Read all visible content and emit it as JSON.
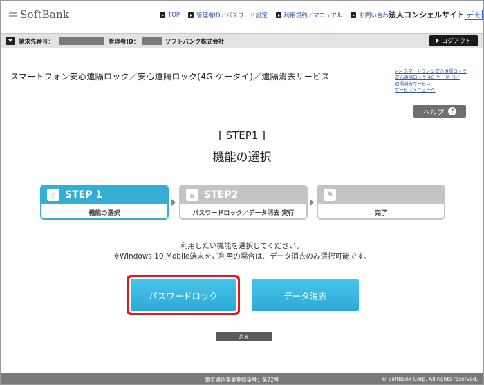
{
  "header": {
    "logo_text": "SoftBank",
    "nav": [
      {
        "label": "TOP"
      },
      {
        "label": "管理者ID／パスワード設定"
      },
      {
        "label": "利用規約／マニュアル"
      },
      {
        "label": "お問い合わせ"
      }
    ],
    "site_title": "法人コンシェルサイト",
    "site_badge": "デモ"
  },
  "account_bar": {
    "billing_label": "請求先番号：",
    "admin_label": "管理者ID：",
    "company": "ソフトバンク株式会社",
    "logout_label": "ログアウト"
  },
  "page": {
    "title": "スマートフォン安心遠隔ロック／安心遠隔ロック(4G ケータイ)／遠隔消去サービス",
    "side_links": [
      ">> スマートフォン安心遠隔ロック",
      "安心遠隔ロック(4G ケータイ)／",
      "遠隔消去サービス",
      "サービスメニューへ"
    ],
    "help_label": "ヘルプ",
    "help_icon_glyph": "?"
  },
  "step_heading": "[ STEP1 ]",
  "step_sub": "機能の選択",
  "steps": [
    {
      "title": "STEP 1",
      "label": "機能の選択",
      "icon": "hand-pointer-icon",
      "active": true
    },
    {
      "title": "STEP2",
      "label": "パスワードロック／データ消去 実行",
      "icon": "lock-icon",
      "active": false
    },
    {
      "title": "",
      "label": "完了",
      "icon": "checkered-flag-icon",
      "active": false
    }
  ],
  "instructions": {
    "line1": "利用したい機能を選択してください。",
    "line2": "※Windows 10 Mobile端末をご利用の場合は、データ消去のみ選択可能です。"
  },
  "buttons": {
    "password_lock": "パスワードロック",
    "data_erase": "データ消去",
    "back": "戻る"
  },
  "footer": {
    "registration": "電気通信事業登録番号：第72号",
    "copyright": "© SoftBank Corp. All rights reserved."
  },
  "colors": {
    "accent": "#35aed6",
    "highlight": "#e0191f",
    "inactive": "#c4c4c4"
  }
}
